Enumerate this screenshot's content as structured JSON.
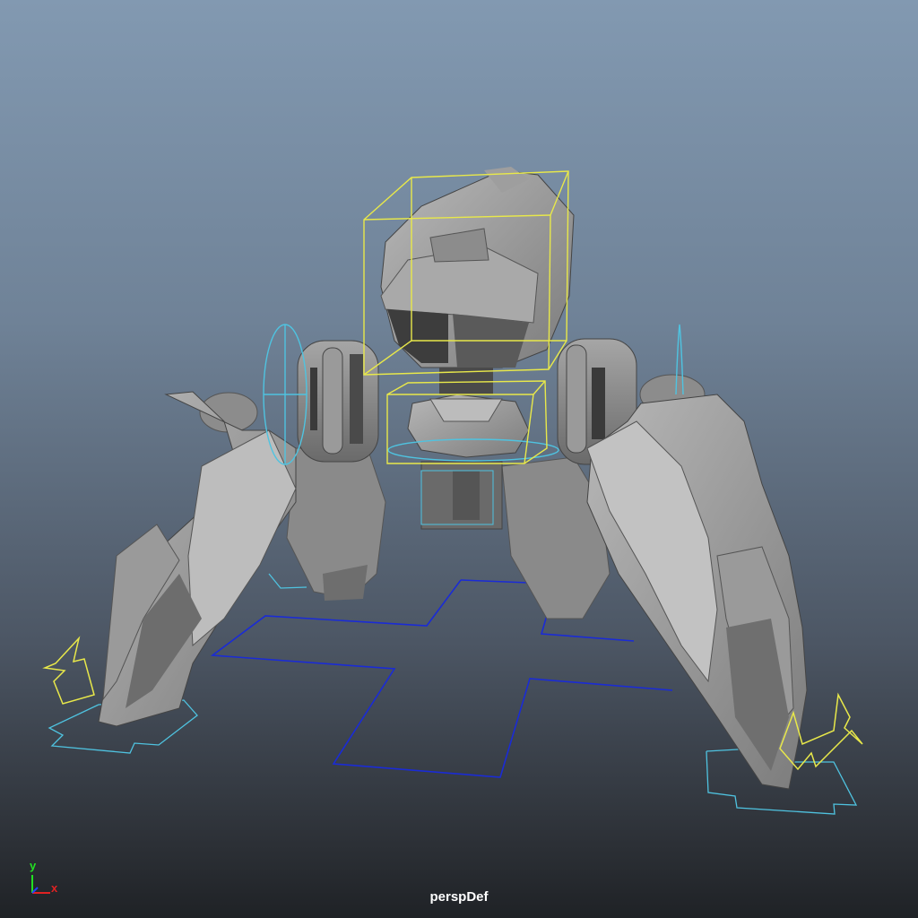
{
  "viewport": {
    "camera_name": "perspDef",
    "background_top": "#8299b1",
    "background_bottom": "#1f2226"
  },
  "axis_indicator": {
    "y_label": "y",
    "x_label": "x",
    "y_color": "#22e022",
    "x_color": "#e02222",
    "z_color": "#2244ff"
  },
  "scene": {
    "model_description_icon": "mech-walker-model",
    "selection_color": "#e8e84a",
    "rig_control_color": "#4fc3e0",
    "ground_plane_color": "#1a2bd6"
  }
}
